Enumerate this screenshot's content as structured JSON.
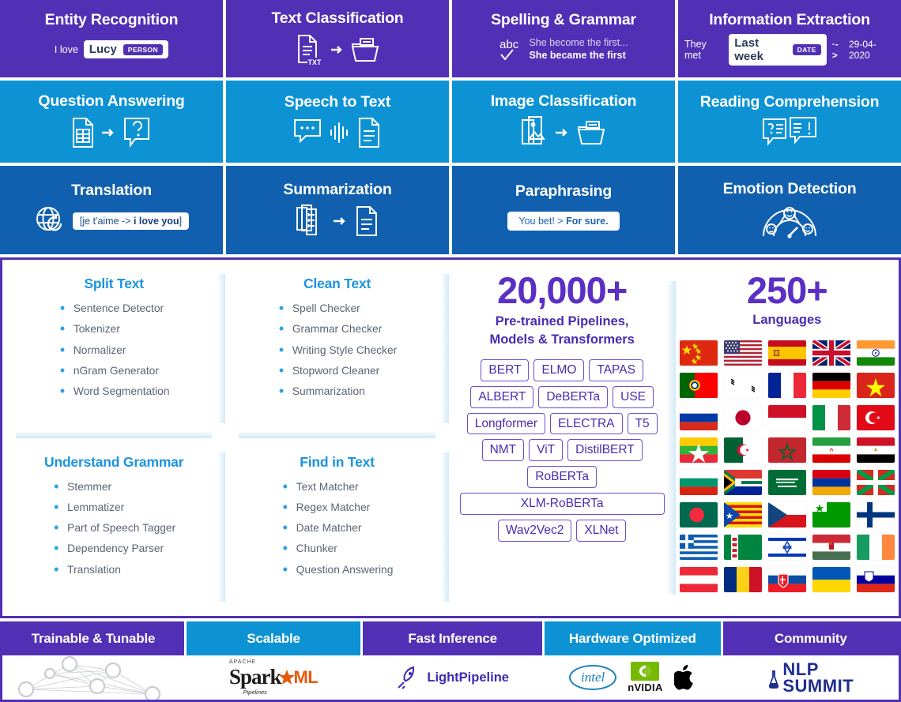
{
  "tasks_row1": [
    {
      "title": "Entity Recognition",
      "style": "purple",
      "visual": "entity",
      "prefix": "I love",
      "word": "Lucy",
      "tag": "PERSON"
    },
    {
      "title": "Text Classification",
      "style": "purple",
      "visual": "doc-to-folder-txt",
      "icon_label": "TXT"
    },
    {
      "title": "Spelling & Grammar",
      "style": "purple",
      "visual": "spelling",
      "line_wrong": "She become the first...",
      "line_right": "She became the first",
      "abc_label": "abc"
    },
    {
      "title": "Information Extraction",
      "style": "purple",
      "visual": "infoext",
      "prefix": "They met",
      "word": "Last week",
      "tag": "DATE",
      "arrow": "·->",
      "result": "29-04-2020"
    }
  ],
  "tasks_row2": [
    {
      "title": "Question Answering",
      "style": "cyan",
      "visual": "table-to-question"
    },
    {
      "title": "Speech to Text",
      "style": "cyan",
      "visual": "speech-to-doc"
    },
    {
      "title": "Image Classification",
      "style": "cyan",
      "visual": "image-to-folder"
    },
    {
      "title": "Reading Comprehension",
      "style": "cyan",
      "visual": "qa-bubbles"
    }
  ],
  "tasks_row3": [
    {
      "title": "Translation",
      "style": "blue",
      "visual": "translation",
      "pill_open": "[je t'aime -> ",
      "pill_bold": "i love you",
      "pill_close": "]"
    },
    {
      "title": "Summarization",
      "style": "blue",
      "visual": "docs-to-doc"
    },
    {
      "title": "Paraphrasing",
      "style": "blue",
      "visual": "paraphrase",
      "pill_lite": "You bet! > ",
      "pill_bold": "For sure."
    },
    {
      "title": "Emotion Detection",
      "style": "blue",
      "visual": "emotion-gauge"
    }
  ],
  "feature_groups": [
    {
      "title": "Split Text",
      "items": [
        "Sentence Detector",
        "Tokenizer",
        "Normalizer",
        "nGram Generator",
        "Word Segmentation"
      ]
    },
    {
      "title": "Clean Text",
      "items": [
        "Spell Checker",
        "Grammar Checker",
        "Writing Style Checker",
        "Stopword Cleaner",
        "Summarization"
      ]
    },
    {
      "title": "Understand Grammar",
      "items": [
        "Stemmer",
        "Lemmatizer",
        "Part of Speech Tagger",
        "Dependency Parser",
        "Translation"
      ]
    },
    {
      "title": "Find in Text",
      "items": [
        "Text Matcher",
        "Regex Matcher",
        "Date Matcher",
        "Chunker",
        "Question Answering"
      ]
    }
  ],
  "models_panel": {
    "count": "20,000+",
    "subtitle_line1": "Pre-trained Pipelines,",
    "subtitle_line2": "Models & Transformers",
    "chips": [
      {
        "label": "BERT",
        "wide": false
      },
      {
        "label": "ELMO",
        "wide": false
      },
      {
        "label": "TAPAS",
        "wide": false
      },
      {
        "label": "ALBERT",
        "wide": false
      },
      {
        "label": "DeBERTa",
        "wide": false
      },
      {
        "label": "USE",
        "wide": false
      },
      {
        "label": "Longformer",
        "wide": false
      },
      {
        "label": "ELECTRA",
        "wide": false
      },
      {
        "label": "T5",
        "wide": false
      },
      {
        "label": "NMT",
        "wide": false
      },
      {
        "label": "ViT",
        "wide": false
      },
      {
        "label": "DistilBERT",
        "wide": false
      },
      {
        "label": "RoBERTa",
        "wide": false
      },
      {
        "label": "XLM-RoBERTa",
        "wide": true
      },
      {
        "label": "Wav2Vec2",
        "wide": false
      },
      {
        "label": "XLNet",
        "wide": false
      }
    ]
  },
  "languages_panel": {
    "count": "250+",
    "subtitle": "Languages",
    "flags": [
      "China",
      "United States",
      "Spain",
      "United Kingdom",
      "India",
      "Portugal",
      "South Korea",
      "France",
      "Germany",
      "Vietnam",
      "Russia",
      "Japan",
      "Indonesia",
      "Italy",
      "Turkey",
      "Myanmar",
      "Algeria",
      "Morocco",
      "Iran",
      "Egypt",
      "Bulgaria",
      "South Africa",
      "Saudi Arabia",
      "Armenia",
      "Basque Country",
      "Bangladesh",
      "Catalonia",
      "Czech Republic",
      "Esperanto",
      "Finland",
      "Greece",
      "Turkmenistan",
      "Israel",
      "Hungary",
      "Ireland",
      "Austria",
      "Romania",
      "Slovakia",
      "Ukraine",
      "Slovenia"
    ]
  },
  "bottom_bar": [
    {
      "title": "Trainable & Tunable",
      "style": "purple",
      "logo": "graph-network"
    },
    {
      "title": "Scalable",
      "style": "cyan",
      "logo": "spark-ml",
      "spark_apache": "APACHE",
      "spark_word": "Spark",
      "spark_ml": "ML",
      "spark_pipelines": "Pipelines"
    },
    {
      "title": "Fast Inference",
      "style": "purple",
      "logo": "lightpipeline",
      "lp_text": "LightPipeline"
    },
    {
      "title": "Hardware Optimized",
      "style": "cyan",
      "logo": "vendors",
      "intel": "intel",
      "nvidia": "nVIDIA",
      "apple": "apple-logo"
    },
    {
      "title": "Community",
      "style": "purple",
      "logo": "nlp-summit",
      "nlp_line1": "NLP",
      "nlp_line2": "SUMMIT"
    }
  ],
  "colors": {
    "purple": "#5130b5",
    "cyan": "#0d93d4",
    "blue": "#1160af",
    "heading_blue": "#1b93e0",
    "list_text": "#5a6473",
    "chip_purple": "#4a2ab2"
  }
}
